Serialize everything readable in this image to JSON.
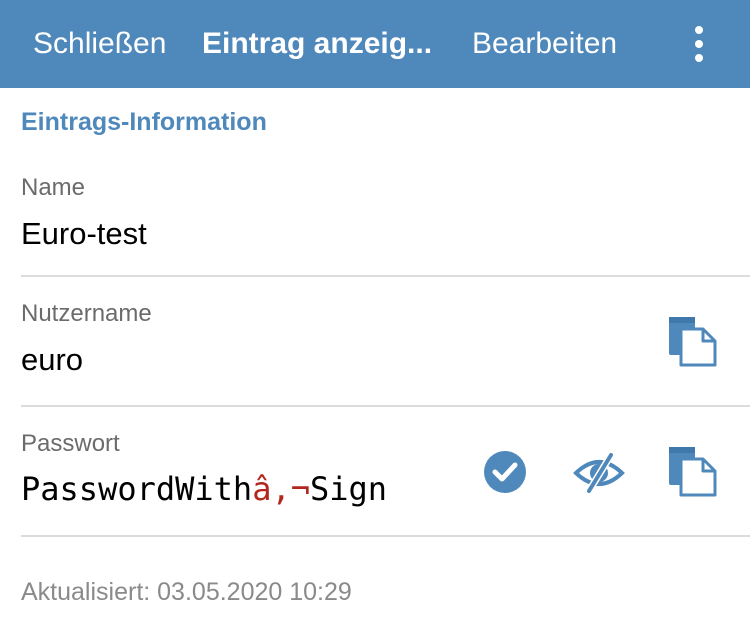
{
  "nav": {
    "close_label": "Schließen",
    "title": "Eintrag anzeig...",
    "edit_label": "Bearbeiten",
    "more_icon": "more-vertical-icon"
  },
  "section": {
    "title": "Eintrags-Information"
  },
  "fields": {
    "name": {
      "label": "Name",
      "value": "Euro-test"
    },
    "username": {
      "label": "Nutzername",
      "value": "euro",
      "copy_icon": "copy-icon"
    },
    "password": {
      "label": "Passwort",
      "value_prefix": "PasswordWith",
      "value_special": "â,¬",
      "value_suffix": "Sign",
      "check_icon": "check-circle-icon",
      "toggle_icon": "eye-slash-icon",
      "copy_icon": "copy-icon"
    }
  },
  "footer": {
    "updated": "Aktualisiert: 03.05.2020 10:29"
  },
  "colors": {
    "accent": "#4f88ba",
    "special_char": "#b3261e"
  }
}
